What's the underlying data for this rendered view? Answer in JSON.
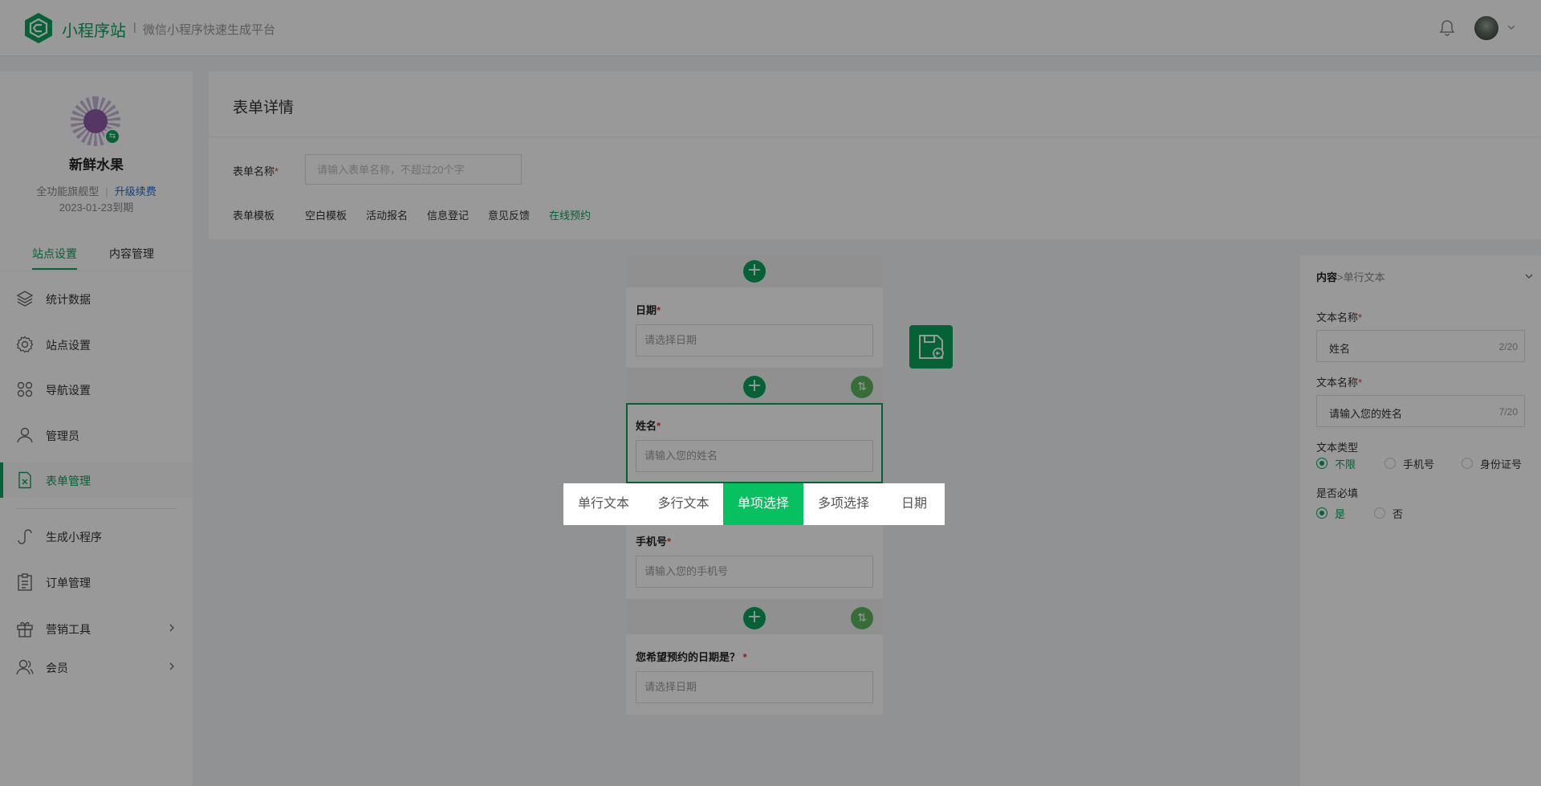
{
  "header": {
    "app_name": "小程序站",
    "separator": "|",
    "tagline": "微信小程序快速生成平台"
  },
  "sidebar": {
    "site_name": "新鲜水果",
    "plan": "全功能旗舰型",
    "plan_sep": "|",
    "upgrade": "升级续费",
    "expire": "2023-01-23到期",
    "tabs": [
      {
        "label": "站点设置",
        "active": true
      },
      {
        "label": "内容管理",
        "active": false
      }
    ],
    "items": [
      {
        "label": "统计数据"
      },
      {
        "label": "站点设置"
      },
      {
        "label": "导航设置"
      },
      {
        "label": "管理员"
      },
      {
        "label": "表单管理",
        "active": true
      },
      {
        "label": "生成小程序"
      },
      {
        "label": "订单管理"
      },
      {
        "label": "营销工具"
      },
      {
        "label": "会员"
      }
    ]
  },
  "main": {
    "title": "表单详情",
    "form_name_label": "表单名称",
    "form_name_placeholder": "请输入表单名称，不超过20个字",
    "template_label": "表单模板",
    "templates": [
      "空白模板",
      "活动报名",
      "信息登记",
      "意见反馈",
      "在线预约"
    ]
  },
  "form_fields": [
    {
      "title": "日期",
      "placeholder": "请选择日期"
    },
    {
      "title": "姓名",
      "placeholder": "请输入您的姓名"
    },
    {
      "title": "手机号",
      "placeholder": "请输入您的手机号"
    },
    {
      "title": "您希望预约的日期是？",
      "placeholder": "请选择日期"
    }
  ],
  "settings": {
    "crumb_root": "内容",
    "crumb_child": ">单行文本",
    "text_name_label": "文本名称",
    "text_name_value": "姓名",
    "text_name_count": "2/20",
    "placeholder_label": "文本名称",
    "placeholder_value": "请输入您的姓名",
    "placeholder_count": "7/20",
    "text_type_label": "文本类型",
    "text_types": [
      "不限",
      "手机号",
      "身份证号"
    ],
    "required_label": "是否必填",
    "required_options": [
      "是",
      "否"
    ]
  },
  "popup": {
    "options": [
      "单行文本",
      "多行文本",
      "单项选择",
      "多项选择",
      "日期"
    ],
    "selected": "单项选择"
  },
  "colors": {
    "brand": "#07a35a",
    "popup_active": "#07c160",
    "required": "#e53935"
  }
}
